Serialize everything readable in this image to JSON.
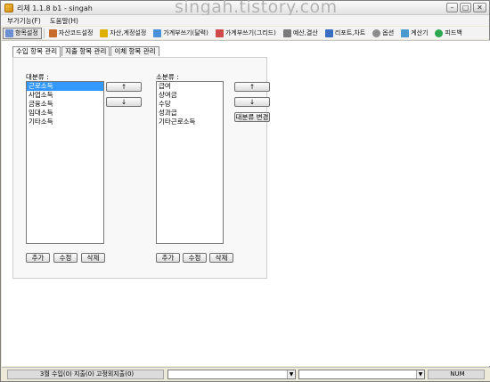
{
  "window": {
    "title": "리체 1.1.8 b1 - singah",
    "watermark": "singah.tistory.com"
  },
  "menu": [
    "부가기능(F)",
    "도움말(H)"
  ],
  "toolbar": [
    {
      "label": "항목설정",
      "icon": "settings-icon",
      "color": "#6b8fd0",
      "active": true
    },
    {
      "label": "자산코드설정",
      "icon": "asset-code-icon",
      "color": "#c86a2a"
    },
    {
      "label": "자산,계정설정",
      "icon": "account-icon",
      "color": "#e0b000"
    },
    {
      "label": "가계부쓰기(달력)",
      "icon": "calendar-icon",
      "color": "#4a90d9"
    },
    {
      "label": "가계부쓰기(그리드)",
      "icon": "grid-icon",
      "color": "#d04a4a"
    },
    {
      "label": "예산,결산",
      "icon": "budget-icon",
      "color": "#7a7a7a"
    },
    {
      "label": "리포트,차트",
      "icon": "chart-icon",
      "color": "#3a6ec2"
    },
    {
      "label": "옵션",
      "icon": "gear-icon",
      "color": "#8c8c8c"
    },
    {
      "label": "계산기",
      "icon": "calculator-icon",
      "color": "#4a9ad0"
    },
    {
      "label": "피드백",
      "icon": "feedback-icon",
      "color": "#2ea84e"
    }
  ],
  "tabs": [
    "수입 항목 관리",
    "지출 항목 관리",
    "이체 항목 관리"
  ],
  "major": {
    "label": "대분류 :",
    "items": [
      "근로소득",
      "사업소득",
      "금융소득",
      "임대소득",
      "기타소득"
    ],
    "selected": 0,
    "buttons": {
      "add": "추가",
      "edit": "수정",
      "delete": "삭제"
    }
  },
  "minor": {
    "label": "소분류 :",
    "items": [
      "급여",
      "상여금",
      "수당",
      "성과급",
      "기타근로소득"
    ],
    "buttons": {
      "add": "추가",
      "edit": "수정",
      "delete": "삭제"
    },
    "change_major": "대분류 변경"
  },
  "move": {
    "up": "↑",
    "down": "↓"
  },
  "status": {
    "summary": "3월 수입(0) 지출(0) 고정외지출(0)",
    "num": "NUM"
  },
  "colors": {
    "selection": "#3399ff"
  }
}
